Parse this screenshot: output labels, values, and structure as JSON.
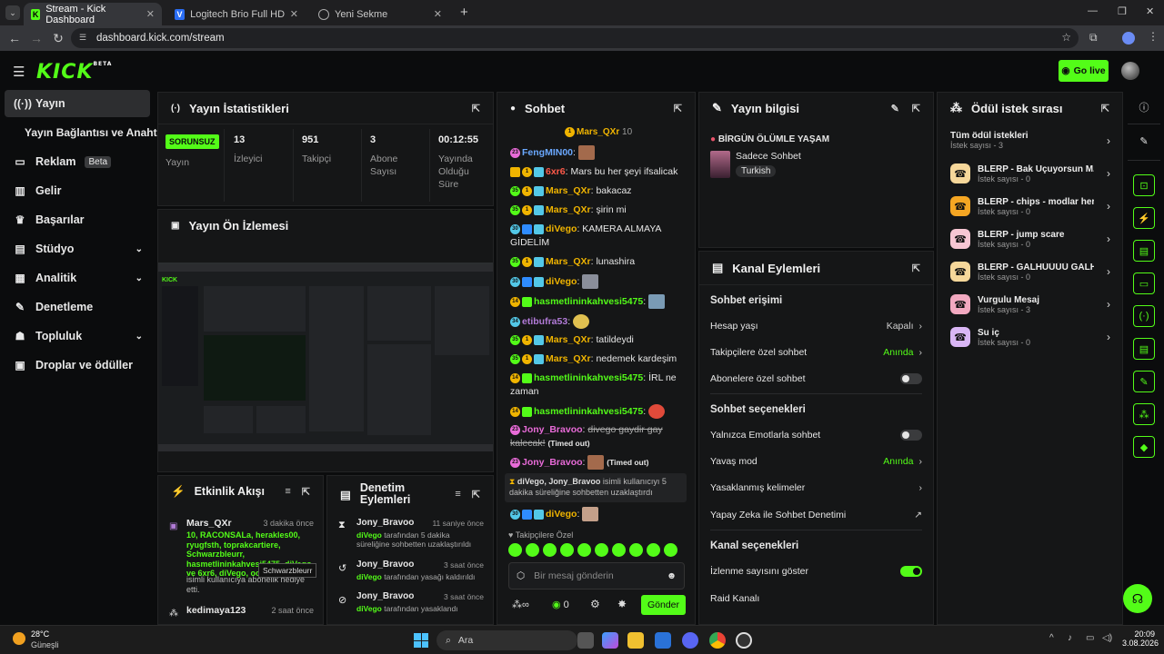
{
  "browser": {
    "tabs": [
      {
        "title": "Stream - Kick Dashboard"
      },
      {
        "title": "Logitech Brio Full HD Web Kam"
      },
      {
        "title": "Yeni Sekme"
      }
    ],
    "url": "dashboard.kick.com/stream"
  },
  "header": {
    "logo": "KICK",
    "logo_sup": "BETA",
    "go_live": "Go live"
  },
  "sidebar": {
    "items": [
      {
        "label": "Yayın"
      },
      {
        "label": "Yayın Bağlantısı ve Anahtarı"
      },
      {
        "label": "Reklam",
        "badge": "Beta"
      },
      {
        "label": "Gelir"
      },
      {
        "label": "Başarılar"
      },
      {
        "label": "Stüdyo"
      },
      {
        "label": "Analitik"
      },
      {
        "label": "Denetleme"
      },
      {
        "label": "Topluluk"
      },
      {
        "label": "Droplar ve ödüller"
      }
    ]
  },
  "stats": {
    "title": "Yayın İstatistikleri",
    "status": "SORUNSUZ",
    "status_label": "Yayın",
    "viewers": "13",
    "viewers_label": "İzleyici",
    "followers": "951",
    "followers_label": "Takipçi",
    "subs": "3",
    "subs_label": "Abone Sayısı",
    "uptime": "00:12:55",
    "uptime_label": "Yayında Olduğu Süre"
  },
  "preview": {
    "title": "Yayın Ön İzlemesi"
  },
  "events": {
    "title": "Etkinlik Akışı",
    "items": [
      {
        "user": "Mars_QXr",
        "time": "3 dakika önce",
        "detail_green": "10, RACONSALa, herakles00, ryugfsth, toprakcartiere, Schwarzbleurr, hasmetlininkahvesi5475, diVego ve 6xr6, diVego, ooob",
        "detail": "isimli kullanıcıya abonelik hediye etti.",
        "tooltip": "Schwarzbleurr"
      },
      {
        "user": "kedimaya123",
        "time": "2 saat önce"
      }
    ]
  },
  "modlog": {
    "title": "Denetim Eylemleri",
    "items": [
      {
        "user": "Jony_Bravoo",
        "time": "11 saniye önce",
        "actor": "diVego",
        "text": "tarafından 5 dakika süreliğine sohbetten uzaklaştırıldı"
      },
      {
        "user": "Jony_Bravoo",
        "time": "3 saat önce",
        "actor": "diVego",
        "text": "tarafından yasağı kaldırıldı"
      },
      {
        "user": "Jony_Bravoo",
        "time": "3 saat önce",
        "actor": "diVego",
        "text": "tarafından yasaklandı"
      }
    ]
  },
  "chat": {
    "title": "Sohbet",
    "pinned_user": "Mars_QXr",
    "pinned_count": "10",
    "messages": [
      {
        "user": "FengMIN00",
        "text": ""
      },
      {
        "user": "6xr6",
        "text": "Mars bu her şeyi ifsalicak"
      },
      {
        "user": "Mars_QXr",
        "text": "bakacaz"
      },
      {
        "user": "Mars_QXr",
        "text": "şirin mi"
      },
      {
        "user": "diVego",
        "text": "KAMERA ALMAYA GİDELİM"
      },
      {
        "user": "Mars_QXr",
        "text": "lunashira"
      },
      {
        "user": "diVego",
        "text": ""
      },
      {
        "user": "hasmetlininkahvesi5475",
        "text": ""
      },
      {
        "user": "etibufra53",
        "text": ""
      },
      {
        "user": "Mars_QXr",
        "text": "tatildeydi"
      },
      {
        "user": "Mars_QXr",
        "text": "nedemek kardeşim"
      },
      {
        "user": "hasmetlininkahvesi5475",
        "text": "İRL ne zaman"
      },
      {
        "user": "hasmetlininkahvesi5475",
        "text": ""
      },
      {
        "user": "Jony_Bravoo",
        "text": "divego gaydir gay kalecak!",
        "note": "(Timed out)"
      },
      {
        "user": "Jony_Bravoo",
        "text": "",
        "note": "(Timed out)"
      },
      {
        "user": "diVego, Jony_Bravoo",
        "text": "isimli kullanıcıyı 5 dakika süreliğine sohbetten uzaklaştırdı"
      },
      {
        "user": "diVego",
        "text": ""
      }
    ],
    "followers_only": "Takipçilere Özel",
    "placeholder": "Bir mesaj gönderin",
    "points": "0",
    "send": "Gönder"
  },
  "info": {
    "title": "Yayın bilgisi",
    "stream_title": "BİRGÜN ÖLÜMLE YAŞAM",
    "category": "Sadece Sohbet",
    "tag": "Turkish"
  },
  "actions": {
    "title": "Kanal Eylemleri",
    "chat_access": "Sohbet erişimi",
    "account_age": "Hesap yaşı",
    "account_age_val": "Kapalı",
    "followers_only": "Takipçilere özel sohbet",
    "followers_only_val": "Anında",
    "subs_only": "Abonelere özel sohbet",
    "chat_options": "Sohbet seçenekleri",
    "emote_only": "Yalnızca Emotlarla sohbet",
    "slow_mode": "Yavaş mod",
    "slow_mode_val": "Anında",
    "banned_words": "Yasaklanmış kelimeler",
    "ai_mod": "Yapay Zeka ile Sohbet Denetimi",
    "channel_options": "Kanal seçenekleri",
    "show_viewers": "İzlenme sayısını göster",
    "raid": "Raid Kanalı"
  },
  "rewards": {
    "title": "Ödül istek sırası",
    "items": [
      {
        "name": "Tüm ödül istekleri",
        "sub": "İstek sayısı - 3",
        "color": ""
      },
      {
        "name": "BLERP - Bak Uçuyorsun M...",
        "sub": "İstek sayısı - 0",
        "color": "#f6d79a"
      },
      {
        "name": "BLERP - chips - modlar her...",
        "sub": "İstek sayısı - 0",
        "color": "#f5a623"
      },
      {
        "name": "BLERP - jump scare",
        "sub": "İstek sayısı - 0",
        "color": "#f7c6d3"
      },
      {
        "name": "BLERP - GALHÜÜÜÜ GALH...",
        "sub": "İstek sayısı - 0",
        "color": "#f6d79a"
      },
      {
        "name": "Vurgulu Mesaj",
        "sub": "İstek sayısı - 3",
        "color": "#f2a9c0"
      },
      {
        "name": "Su iç",
        "sub": "İstek sayısı - 0",
        "color": "#d9b6f5"
      }
    ]
  },
  "taskbar": {
    "temp": "28°C",
    "weather": "Güneşli",
    "search": "Ara",
    "time": "20:09",
    "date": "3.08.2026"
  }
}
